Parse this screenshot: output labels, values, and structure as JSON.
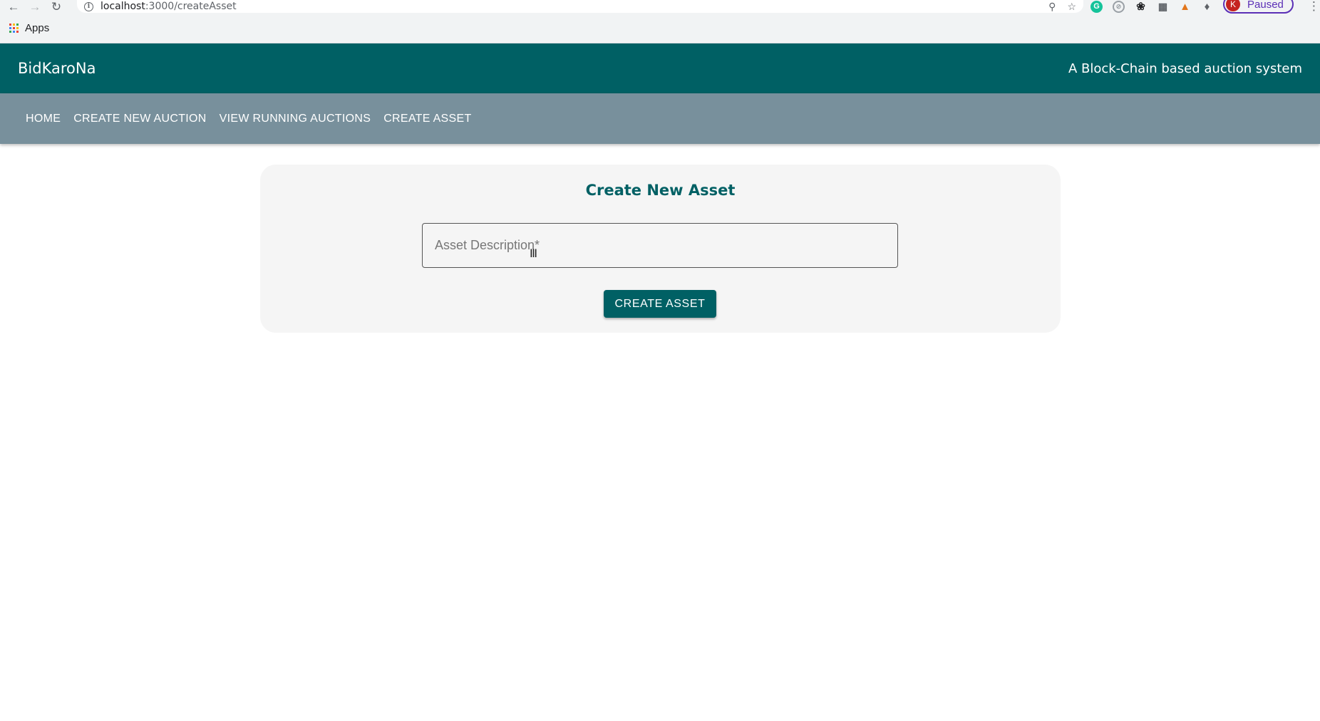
{
  "browser": {
    "url_host": "localhost",
    "url_path": ":3000/createAsset",
    "profile_initial": "K",
    "profile_status": "Paused",
    "bookmarks": {
      "apps_label": "Apps"
    }
  },
  "header": {
    "brand": "BidKaroNa",
    "tagline": "A Block-Chain based auction system"
  },
  "nav": {
    "items": [
      {
        "label": "HOME"
      },
      {
        "label": "CREATE NEW AUCTION"
      },
      {
        "label": "VIEW RUNNING AUCTIONS"
      },
      {
        "label": "CREATE ASSET"
      }
    ]
  },
  "form": {
    "title": "Create New Asset",
    "description_placeholder": "Asset Description*",
    "description_value": "",
    "submit_label": "CREATE ASSET"
  },
  "colors": {
    "header_bg": "#006064",
    "nav_bg": "#78909c",
    "card_bg": "#f5f5f5",
    "accent": "#006064",
    "profile_accent": "#5b2fb6"
  }
}
